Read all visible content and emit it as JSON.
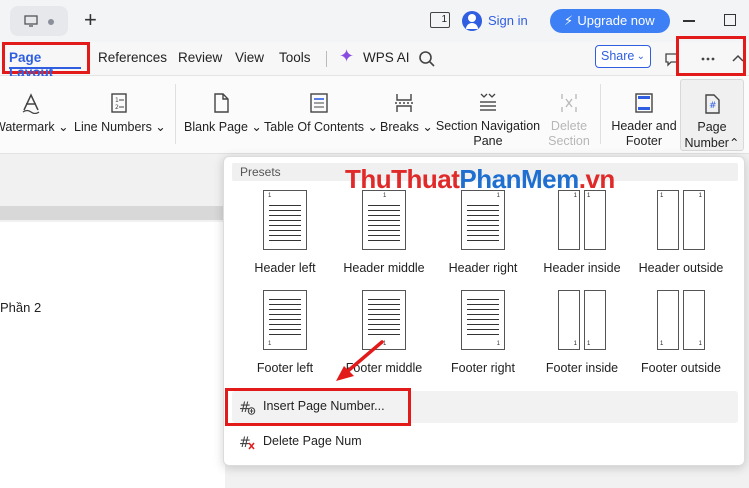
{
  "titlebar": {
    "tab_count": "1",
    "signin_label": "Sign in",
    "upgrade_label": "Upgrade now"
  },
  "menubar": {
    "active_tab": "Page Layout",
    "tabs": [
      "References",
      "Review",
      "View",
      "Tools"
    ],
    "wps_ai_label": "WPS AI",
    "share_label": "Share"
  },
  "ribbon": {
    "watermark": "Watermark",
    "line_numbers": "Line Numbers",
    "blank_page": "Blank Page",
    "toc": "Table Of Contents",
    "breaks": "Breaks",
    "section_nav_1": "Section Navigation",
    "section_nav_2": "Pane",
    "delete_section_1": "Delete",
    "delete_section_2": "Section",
    "header_footer_1": "Header and",
    "header_footer_2": "Footer",
    "page_number_1": "Page",
    "page_number_2": "Number"
  },
  "document": {
    "visible_text": "Phần 2"
  },
  "watermark": {
    "part1": "ThuThuat",
    "part2": "PhanMem",
    "part3": ".vn"
  },
  "dropdown": {
    "presets_label": "Presets",
    "presets": [
      {
        "label": "Header left"
      },
      {
        "label": "Header middle"
      },
      {
        "label": "Header right"
      },
      {
        "label": "Header inside"
      },
      {
        "label": "Header outside"
      },
      {
        "label": "Footer left"
      },
      {
        "label": "Footer middle"
      },
      {
        "label": "Footer right"
      },
      {
        "label": "Footer inside"
      },
      {
        "label": "Footer outside"
      }
    ],
    "insert_label": "Insert Page Number...",
    "delete_label": "Delete Page Num"
  },
  "colors": {
    "accent": "#2f5fe0",
    "highlight_box": "#e21a1a",
    "upgrade_button": "#3d7ff5"
  }
}
